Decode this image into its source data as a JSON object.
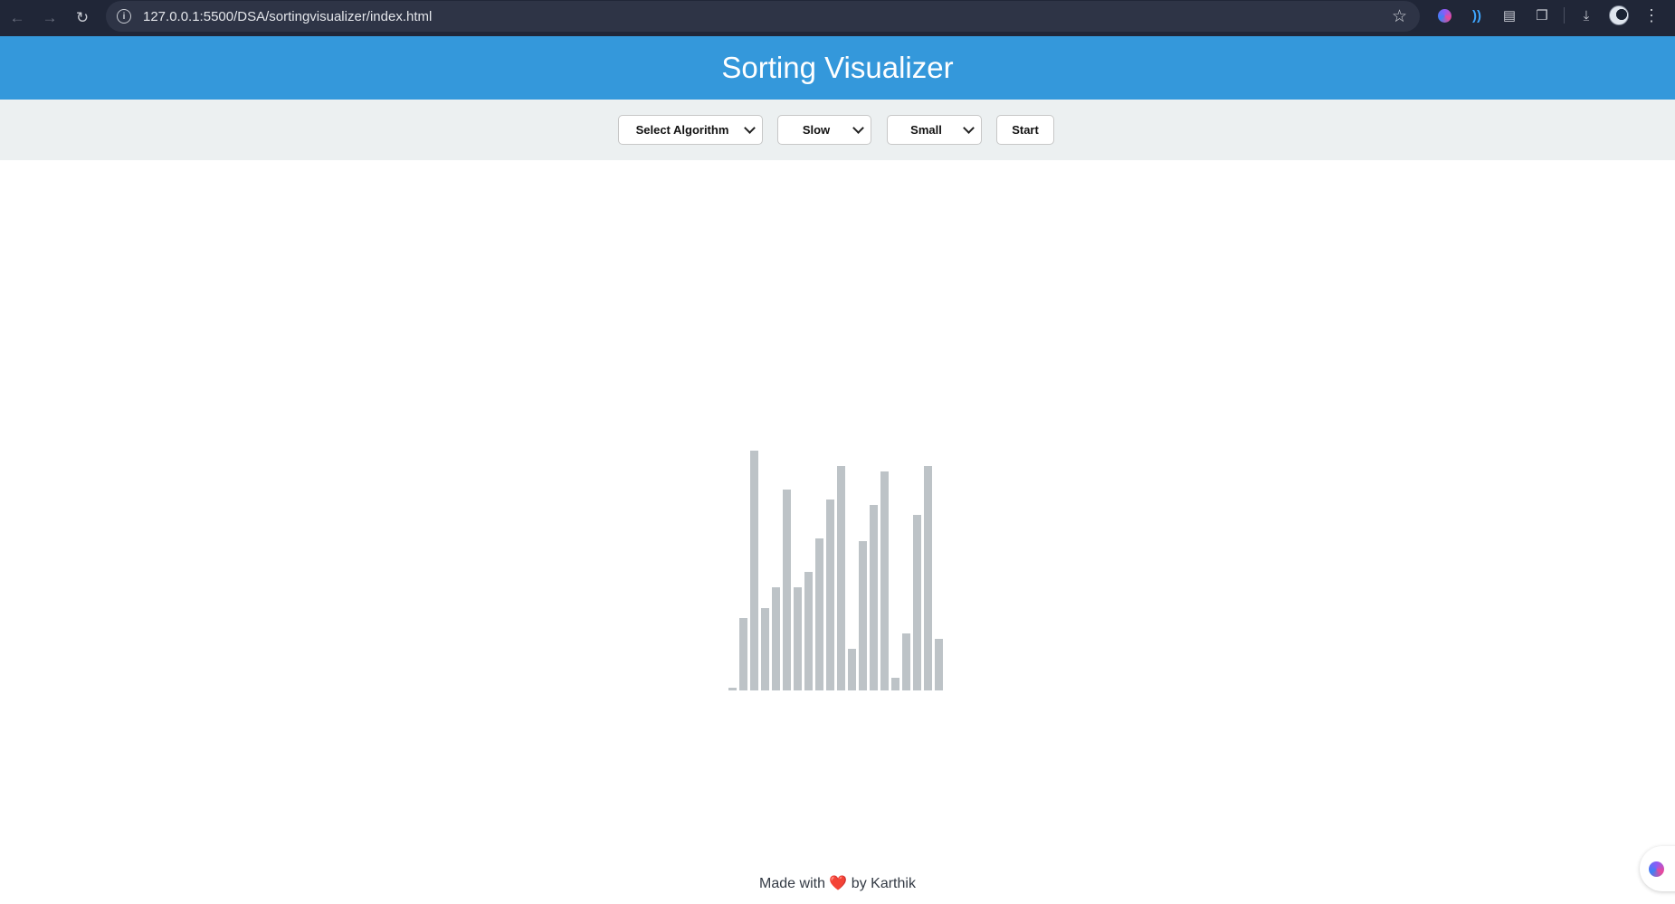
{
  "browser": {
    "url": "127.0.0.1:5500/DSA/sortingvisualizer/index.html"
  },
  "page": {
    "title": "Sorting Visualizer"
  },
  "controls": {
    "algorithm": "Select Algorithm",
    "speed": "Slow",
    "size": "Small",
    "start": "Start"
  },
  "chart_data": {
    "type": "bar",
    "values": [
      1,
      28,
      93,
      32,
      40,
      78,
      40,
      46,
      59,
      74,
      87,
      16,
      58,
      72,
      85,
      5,
      22,
      68,
      87,
      20
    ],
    "color": "#bdc3c7"
  },
  "footer": {
    "prefix": "Made with",
    "heart": "❤️",
    "suffix": "by Karthik"
  },
  "colors": {
    "header": "#3498db",
    "controls_bg": "#ecf0f1",
    "bar": "#bdc3c7"
  }
}
